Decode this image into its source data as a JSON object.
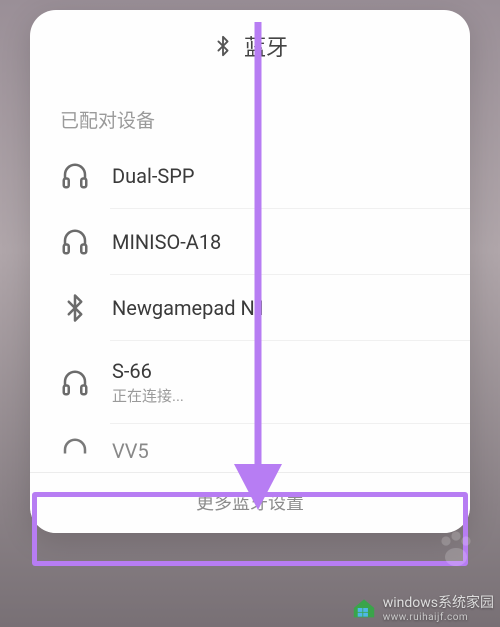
{
  "header": {
    "title": "蓝牙"
  },
  "section": {
    "paired_label": "已配对设备"
  },
  "devices": [
    {
      "name": "Dual-SPP",
      "status": "",
      "icon": "headphones"
    },
    {
      "name": "MINISO-A18",
      "status": "",
      "icon": "headphones"
    },
    {
      "name": "Newgamepad N1",
      "status": "",
      "icon": "bluetooth"
    },
    {
      "name": "S-66",
      "status": "正在连接...",
      "icon": "headphones"
    },
    {
      "name": "VV5",
      "status": "",
      "icon": "headphones"
    }
  ],
  "footer": {
    "more_settings": "更多蓝牙设置"
  },
  "watermark": {
    "brand": "windows系统家园",
    "url": "www.ruihaijf.com"
  },
  "annotation": {
    "arrow_color": "#b77df3",
    "highlight_color": "#b77df3"
  }
}
